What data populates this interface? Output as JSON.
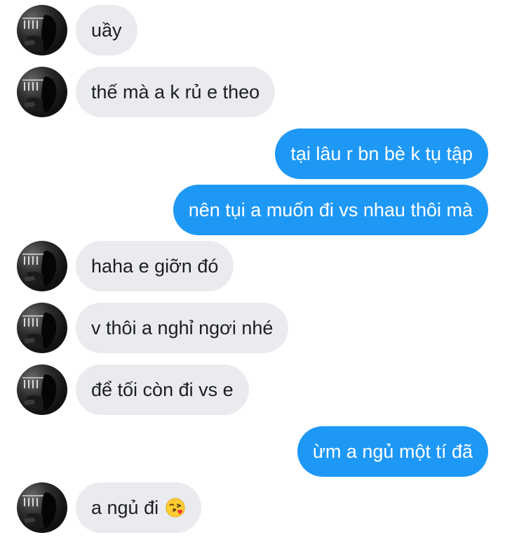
{
  "messages": [
    {
      "from": "them",
      "text": "uầy"
    },
    {
      "from": "them",
      "text": "thế mà a k rủ e theo"
    },
    {
      "from": "me",
      "text": "tại lâu r bn bè k tụ tập"
    },
    {
      "from": "me",
      "text": "nên tụi a muốn đi vs nhau thôi mà"
    },
    {
      "from": "them",
      "text": "haha e giỡn đó"
    },
    {
      "from": "them",
      "text": "v thôi a nghỉ ngơi nhé"
    },
    {
      "from": "them",
      "text": "để tối còn đi vs e"
    },
    {
      "from": "me",
      "text": "ừm a ngủ một tí đã"
    },
    {
      "from": "them",
      "text": "a ngủ đi",
      "emoji": "face-blowing-kiss-emoji"
    }
  ],
  "colors": {
    "incoming_bubble": "#e9ebef",
    "outgoing_bubble": "#1e98f5",
    "incoming_text": "#1c1e21",
    "outgoing_text": "#ffffff"
  }
}
